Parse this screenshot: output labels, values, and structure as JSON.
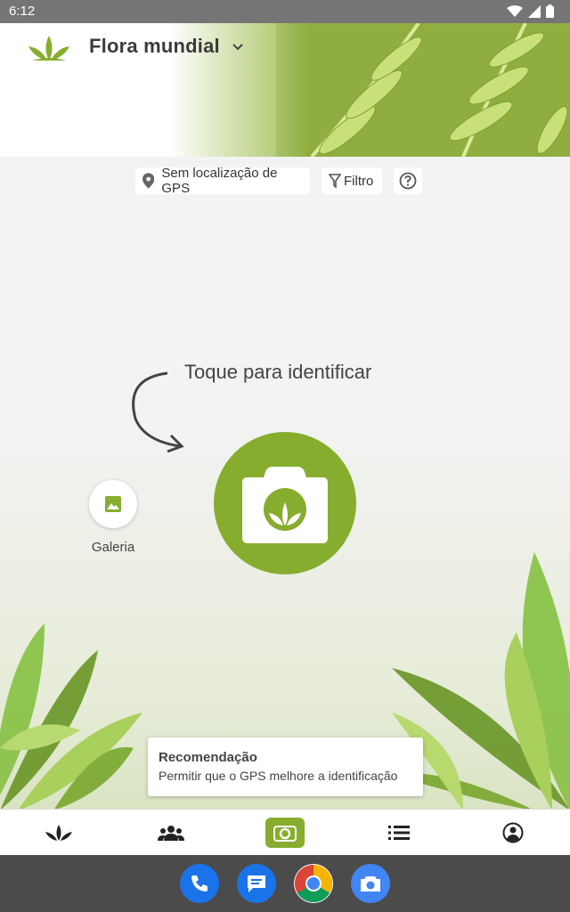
{
  "status_bar": {
    "time": "6:12"
  },
  "header": {
    "app_title": "Flora mundial"
  },
  "chips": {
    "gps_label": "Sem localização de GPS",
    "filter_label": "Filtro"
  },
  "main": {
    "tap_hint": "Toque para identificar",
    "gallery_label": "Galeria"
  },
  "tooltip": {
    "title": "Recomendação",
    "body": "Permitir que o GPS melhore a identificação"
  },
  "bottom_nav": {
    "items": [
      "plants-icon",
      "community-icon",
      "camera-icon",
      "list-icon",
      "profile-icon"
    ],
    "active_index": 2
  },
  "dock": {
    "apps": [
      "phone-icon",
      "messages-icon",
      "chrome-icon",
      "camera-app-icon"
    ]
  },
  "colors": {
    "accent": "#86ad2e",
    "status_bar": "#757575",
    "dock": "#4b4b4b"
  }
}
